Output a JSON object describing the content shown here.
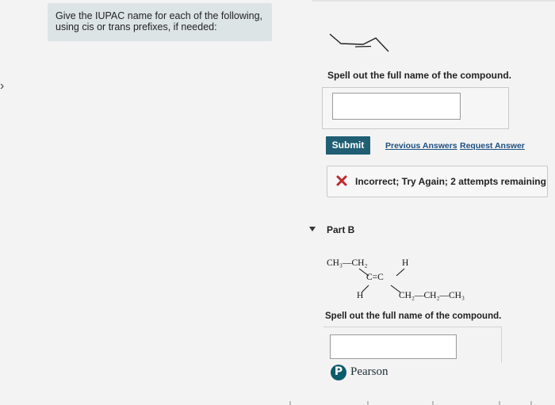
{
  "instructions": "Give the IUPAC name for each of the following, using cis or trans prefixes, if needed:",
  "part_a": {
    "prompt": "Spell out the full name of the compound.",
    "answer_value": "",
    "submit_label": "Submit",
    "previous_answers_label": "Previous Answers",
    "request_answer_label": "Request Answer",
    "feedback": "Incorrect; Try Again; 2 attempts remaining"
  },
  "part_b": {
    "title": "Part B",
    "structure": {
      "upper_left": "CH₃—CH₂",
      "upper_right": "H",
      "double_bond": "C=C",
      "lower_left": "H",
      "lower_right": "CH₂—CH₂—CH₃"
    },
    "prompt": "Spell out the full name of the compound.",
    "answer_value": ""
  },
  "footer": {
    "brand": "Pearson",
    "logo_letter": "P"
  },
  "icons": {
    "feedback": "x-icon",
    "collapse": "caret-down-icon",
    "nav": "chevron-right-icon"
  },
  "colors": {
    "submit_bg": "#1f5e73",
    "link": "#1d4f80",
    "error": "#c0282d",
    "instructions_bg": "#dde4e6",
    "pearson": "#0d5b6b"
  }
}
